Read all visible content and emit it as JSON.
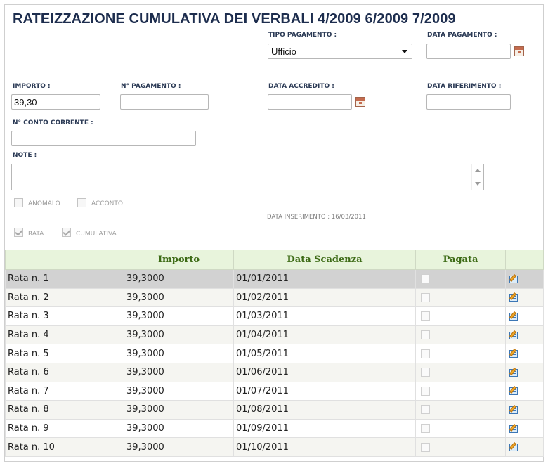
{
  "title": "RATEIZZAZIONE CUMULATIVA DEI VERBALI 4/2009 6/2009 7/2009",
  "form": {
    "tipo_pagamento_label": "TIPO PAGAMENTO :",
    "tipo_pagamento_value": "Ufficio",
    "data_pagamento_label": "DATA PAGAMENTO :",
    "data_pagamento_value": "",
    "importo_label": "IMPORTO :",
    "importo_value": "39,30",
    "n_pagamento_label": "N° PAGAMENTO :",
    "n_pagamento_value": "",
    "data_accredito_label": "DATA ACCREDITO :",
    "data_accredito_value": "",
    "data_riferimento_label": "DATA RIFERIMENTO :",
    "data_riferimento_value": "",
    "conto_corrente_label": "N° CONTO CORRENTE :",
    "conto_corrente_value": "",
    "note_label": "NOTE :",
    "note_value": "",
    "anomalo_label": "ANOMALO",
    "anomalo_checked": false,
    "acconto_label": "ACCONTO",
    "acconto_checked": false,
    "rata_label": "RATA",
    "rata_checked": true,
    "cumulativa_label": "CUMULATIVA",
    "cumulativa_checked": true,
    "data_inserimento": "DATA INSERIMENTO : 16/03/2011"
  },
  "table": {
    "headers": [
      "",
      "Importo",
      "Data Scadenza",
      "Pagata",
      ""
    ],
    "rows": [
      {
        "rata": "Rata n. 1",
        "importo": "39,3000",
        "scadenza": "01/01/2011"
      },
      {
        "rata": "Rata n. 2",
        "importo": "39,3000",
        "scadenza": "01/02/2011"
      },
      {
        "rata": "Rata n. 3",
        "importo": "39,3000",
        "scadenza": "01/03/2011"
      },
      {
        "rata": "Rata n. 4",
        "importo": "39,3000",
        "scadenza": "01/04/2011"
      },
      {
        "rata": "Rata n. 5",
        "importo": "39,3000",
        "scadenza": "01/05/2011"
      },
      {
        "rata": "Rata n. 6",
        "importo": "39,3000",
        "scadenza": "01/06/2011"
      },
      {
        "rata": "Rata n. 7",
        "importo": "39,3000",
        "scadenza": "01/07/2011"
      },
      {
        "rata": "Rata n. 8",
        "importo": "39,3000",
        "scadenza": "01/08/2011"
      },
      {
        "rata": "Rata n. 9",
        "importo": "39,3000",
        "scadenza": "01/09/2011"
      },
      {
        "rata": "Rata n. 10",
        "importo": "39,3000",
        "scadenza": "01/10/2011"
      }
    ],
    "selected_row": 0
  },
  "icons": {
    "calendar": "calendar-icon",
    "edit": "edit-icon",
    "dropdown": "chevron-down-icon"
  }
}
